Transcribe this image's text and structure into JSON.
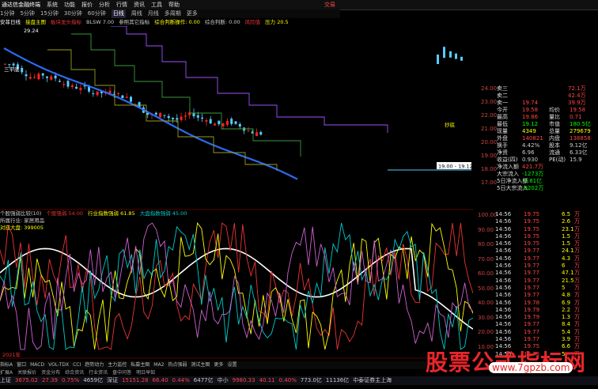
{
  "menubar": {
    "title": "通达信金融终端",
    "items": [
      "系统",
      "功能",
      "报价",
      "分析",
      "行情",
      "资讯",
      "工具",
      "帮助"
    ],
    "right": "交易"
  },
  "timeframes": [
    "1分钟",
    "5分钟",
    "15分钟",
    "30分钟",
    "60分钟",
    "日线",
    "周线",
    "月线",
    "多周期",
    "更多"
  ],
  "indicator_line": [
    {
      "text": "安菲日线",
      "color": "#fff"
    },
    {
      "text": "接盘主图",
      "color": "#ff0"
    },
    {
      "text": "板块龙头指标",
      "color": "#e33"
    },
    {
      "text": "BLSW 7.00",
      "color": "#ccc"
    },
    {
      "text": "参照其它指标",
      "color": "#ccc"
    },
    {
      "text": "综合判断操作: 0.00",
      "color": "#ff0"
    },
    {
      "text": "综合判断: 0.00",
      "color": "#ccc"
    },
    {
      "text": "风险值",
      "color": "#e33"
    },
    {
      "text": "压力 20.5",
      "color": "#ff0"
    }
  ],
  "chart_labels": {
    "price_high": "29.24",
    "tag_left": "三平底",
    "range_label": "19.00 - 19.12",
    "note_right": "抄底"
  },
  "main_axis": [
    "24.00",
    "23.00",
    "22.00",
    "21.00",
    "20.00",
    "19.00",
    "18.00",
    "17.00"
  ],
  "quote_panel": [
    {
      "l": "卖三",
      "v1": "",
      "v2": "72.1万",
      "c": "#f44"
    },
    {
      "l": "卖二",
      "v1": "",
      "v2": "42.4万",
      "c": "#f44"
    },
    {
      "l": "卖一",
      "v1": "19.74",
      "v2": "39.9万",
      "c": "#f44"
    },
    {
      "l": "今开",
      "v1": "19.58",
      "l2": "均价",
      "v3": "19.58",
      "c": "#f44"
    },
    {
      "l": "最高",
      "v1": "19.86",
      "l2": "量比",
      "v3": "0.71",
      "c": "#f44"
    },
    {
      "l": "最低",
      "v1": "19.12",
      "l2": "市值",
      "v3": "180.5亿",
      "c": "#0f0"
    },
    {
      "l": "现量",
      "v1": "4349",
      "l2": "总量",
      "v3": "279679",
      "c": "#ff0"
    },
    {
      "l": "外盘",
      "v1": "140821",
      "l2": "内盘",
      "v3": "138858",
      "c": "#f44"
    },
    {
      "l": "换手",
      "v1": "4.42%",
      "l2": "股本",
      "v3": "9.12亿",
      "c": "#ccc"
    },
    {
      "l": "净资",
      "v1": "6.96",
      "l2": "流通",
      "v3": "6.33亿",
      "c": "#ccc"
    },
    {
      "l": "收益(四)",
      "v1": "0.930",
      "l2": "PE(动)",
      "v3": "15.9",
      "c": "#ccc"
    },
    {
      "l": "净流入额",
      "v1": "421.7万",
      "c": "#f44"
    },
    {
      "l": "大宗流入",
      "v1": "-1273万",
      "c": "#0f0"
    },
    {
      "l": "5日净流入额",
      "v1": "-2.81亿",
      "c": "#0f0"
    },
    {
      "l": "5日大宗流入",
      "v1": "-9202万",
      "c": "#0f0"
    }
  ],
  "ticks": [
    {
      "t": "14:56",
      "p": "19.75",
      "v": "6.5",
      "s": "万"
    },
    {
      "t": "14:56",
      "p": "19.75",
      "v": "2.6",
      "s": "万"
    },
    {
      "t": "14:56",
      "p": "19.75",
      "v": "23.1",
      "s": "万"
    },
    {
      "t": "14:56",
      "p": "19.75",
      "v": "1.5",
      "s": "万"
    },
    {
      "t": "14:56",
      "p": "19.75",
      "v": "1.5",
      "s": "万"
    },
    {
      "t": "14:56",
      "p": "19.77",
      "v": "24.1",
      "s": "万"
    },
    {
      "t": "14:56",
      "p": "19.77",
      "v": "4.3",
      "s": "万"
    },
    {
      "t": "14:56",
      "p": "19.77",
      "v": "6",
      "s": "万"
    },
    {
      "t": "14:56",
      "p": "19.77",
      "v": "47.1",
      "s": "万"
    },
    {
      "t": "14:56",
      "p": "19.77",
      "v": "21.5",
      "s": "万"
    },
    {
      "t": "14:56",
      "p": "19.77",
      "v": "5",
      "s": "万"
    },
    {
      "t": "14:56",
      "p": "19.77",
      "v": "4.8",
      "s": "万"
    },
    {
      "t": "14:56",
      "p": "19.78",
      "v": "6.9",
      "s": "万"
    },
    {
      "t": "14:56",
      "p": "19.79",
      "v": "2.2",
      "s": "万"
    },
    {
      "t": "14:56",
      "p": "19.79",
      "v": "1.3",
      "s": "万"
    },
    {
      "t": "14:56",
      "p": "19.77",
      "v": "8.4",
      "s": "万"
    },
    {
      "t": "14:56",
      "p": "19.77",
      "v": "5.4",
      "s": "万"
    },
    {
      "t": "14:56",
      "p": "19.77",
      "v": "3.9",
      "s": "万"
    },
    {
      "t": "14:56",
      "p": "19.75",
      "v": "6.6",
      "s": "万"
    },
    {
      "t": "14:56",
      "p": "19.75",
      "v": "5",
      "s": "万"
    }
  ],
  "sub_head": {
    "line1": [
      {
        "text": "个股强弱比较(10)",
        "color": "#ccc"
      },
      {
        "text": "个股强弱 54.00",
        "color": "#e33"
      },
      {
        "text": "行业指数强弱 61.85",
        "color": "#ff0"
      },
      {
        "text": "大盘指数强弱 45.00",
        "color": "#0cc"
      }
    ],
    "line2": [
      {
        "text": "所属行业: 家居用品",
        "color": "#ccc"
      }
    ],
    "line3": [
      {
        "text": "对应大盘: 399005",
        "color": "#ff0"
      }
    ]
  },
  "sub_axis": [
    "100.00",
    "90.00",
    "80.00",
    "70.00",
    "60.00",
    "50.00",
    "40.00",
    "30.00",
    "20.00",
    "10.00"
  ],
  "year_label": "2021年",
  "bottom_tabs": [
    "指标A",
    "窗口",
    "MACD",
    "VOL-TDX",
    "CCI",
    "趋势动力",
    "主力监控",
    "私募主图",
    "MA2",
    "热点强弱",
    "测试主图",
    "更多",
    "设置"
  ],
  "bottom_tabs2": [
    "扩展A",
    "关联报价",
    "资金分布",
    "综合资讯",
    "行业资讯",
    "盘中问答",
    "明日早知"
  ],
  "status": [
    {
      "text": "上证",
      "color": "#ccc"
    },
    {
      "text": "3675.02",
      "color": "#f44"
    },
    {
      "text": "27.39",
      "color": "#f44"
    },
    {
      "text": "0.75%",
      "color": "#f44"
    },
    {
      "text": "4659亿",
      "color": "#ccc"
    },
    {
      "text": "深证",
      "color": "#ccc"
    },
    {
      "text": "15151.28",
      "color": "#f44"
    },
    {
      "text": "66.40",
      "color": "#f44"
    },
    {
      "text": "0.44%",
      "color": "#f44"
    },
    {
      "text": "6477亿",
      "color": "#ccc"
    },
    {
      "text": "中小",
      "color": "#ccc"
    },
    {
      "text": "9980.33",
      "color": "#f44"
    },
    {
      "text": "40.11",
      "color": "#f44"
    },
    {
      "text": "0.40%",
      "color": "#f44"
    },
    {
      "text": "773.0亿",
      "color": "#ccc"
    },
    {
      "text": "11136亿",
      "color": "#ccc"
    },
    {
      "text": "中泰证券主上海",
      "color": "#ccc"
    }
  ],
  "watermark": {
    "big": "股票公式指标网",
    "url": "www.7gpzb.com"
  }
}
